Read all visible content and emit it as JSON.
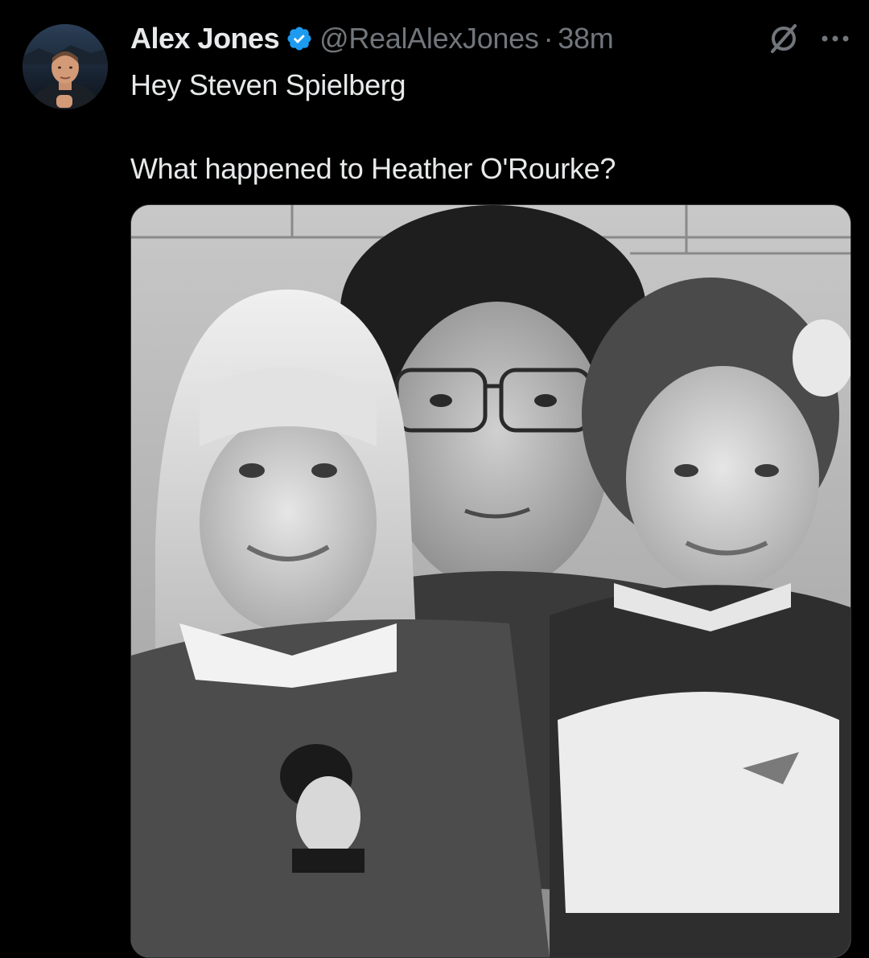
{
  "author": {
    "display_name": "Alex Jones",
    "handle": "@RealAlexJones",
    "separator": "·",
    "time": "38m",
    "verified": true,
    "avatar_icon": "profile-photo"
  },
  "tweet": {
    "lines": [
      "Hey Steven Spielberg",
      "",
      "What happened to Heather O'Rourke?"
    ]
  },
  "actions": {
    "grok_icon": "grok-icon",
    "more_icon": "more-icon"
  },
  "colors": {
    "background": "#000000",
    "text_primary": "#e7e9ea",
    "text_secondary": "#71767b",
    "verified_blue": "#1d9bf0"
  },
  "media": {
    "type": "photo",
    "description_icon": "black-and-white-photo"
  }
}
